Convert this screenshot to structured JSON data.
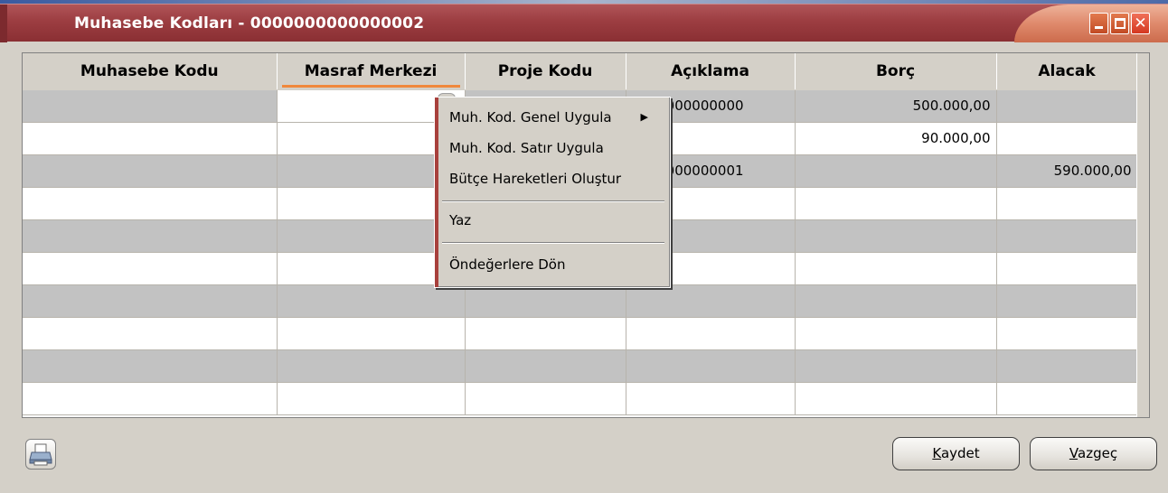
{
  "window": {
    "title": "Muhasebe Kodları - 0000000000000002"
  },
  "grid": {
    "columns": [
      "Muhasebe  Kodu",
      "Masraf Merkezi",
      "Proje Kodu",
      "Açıklama",
      "Borç",
      "Alacak"
    ],
    "rows": [
      [
        "",
        "",
        "",
        "0000000000000",
        "500.000,00",
        ""
      ],
      [
        "",
        "",
        "",
        "",
        "90.000,00",
        ""
      ],
      [
        "",
        "",
        "",
        "0000000000001",
        "",
        "590.000,00"
      ],
      [
        "",
        "",
        "",
        "",
        "",
        ""
      ],
      [
        "",
        "",
        "",
        "",
        "",
        ""
      ],
      [
        "",
        "",
        "",
        "",
        "",
        ""
      ],
      [
        "",
        "",
        "",
        "",
        "",
        ""
      ],
      [
        "",
        "",
        "",
        "",
        "",
        ""
      ],
      [
        "",
        "",
        "",
        "",
        "",
        ""
      ],
      [
        "",
        "",
        "",
        "",
        "",
        ""
      ]
    ]
  },
  "context_menu": {
    "items": [
      {
        "label": "Muh. Kod. Genel  Uygula",
        "has_submenu": true
      },
      {
        "label": "Muh. Kod. Satır Uygula"
      },
      {
        "label": "Bütçe Hareketleri Oluştur"
      },
      {
        "label": "Yaz"
      },
      {
        "label": "Öndeğerlere Dön"
      }
    ]
  },
  "footer": {
    "save_mnemonic": "K",
    "save_rest": "aydet",
    "cancel_mnemonic": "V",
    "cancel_rest": "azgeç"
  },
  "icons": {
    "print": "printer-icon",
    "submenu": "submenu-arrow-icon"
  },
  "colors": {
    "title_bar": "#9c3d41",
    "header_underline": "#f0883c",
    "row_alt": "#c2c2c2",
    "window_bg": "#d4d0c8"
  }
}
